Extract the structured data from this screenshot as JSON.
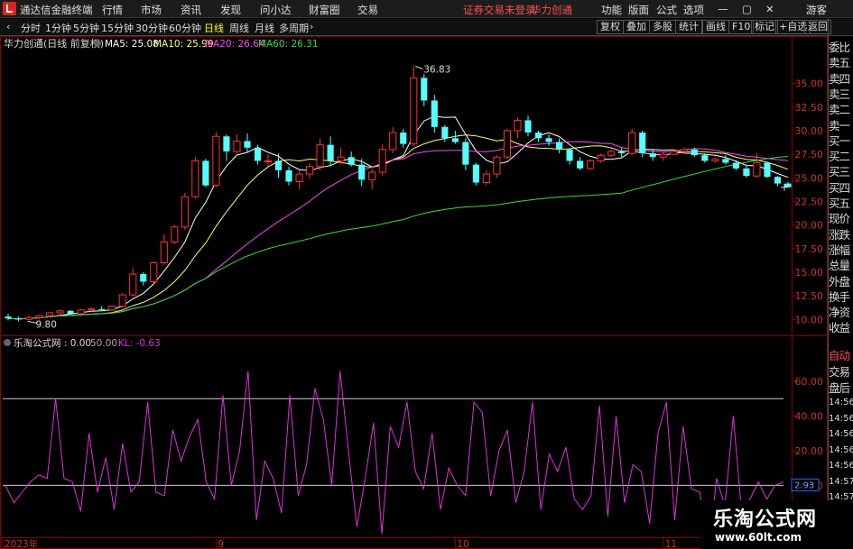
{
  "titlebar": {
    "app_name": "通达信金融终端",
    "menus": [
      "行情",
      "市场",
      "资讯",
      "发现",
      "问小达",
      "财富圈",
      "交易"
    ],
    "notice": "证券交易未登录",
    "stock_name": "华力创通",
    "right_menus": [
      "功能",
      "版面",
      "公式",
      "选项"
    ],
    "guest": "游客"
  },
  "toolbar": {
    "periods": [
      "分时",
      "1分钟",
      "5分钟",
      "15分钟",
      "30分钟",
      "60分钟",
      "日线",
      "周线",
      "月线",
      "多周期"
    ],
    "active_period": "日线",
    "buttons": [
      "复权",
      "叠加",
      "多股",
      "统计",
      "画线",
      "F10",
      "标记",
      "+自选",
      "返回"
    ]
  },
  "sidebar": {
    "items": [
      "委比",
      "卖五",
      "卖四",
      "卖三",
      "卖二",
      "卖一",
      "买一",
      "买二",
      "买三",
      "买四",
      "买五",
      "现价",
      "涨跌",
      "涨幅",
      "总量",
      "外盘",
      "换手",
      "净资",
      "收益"
    ],
    "lower_items": [
      "自动",
      "交易",
      "盘后"
    ],
    "times": [
      "14:56",
      "14:56",
      "14:56",
      "14:56",
      "14:56",
      "14:57",
      "14:57"
    ]
  },
  "main_chart": {
    "stock_title": "华力创通(日线 前复权)",
    "ma": [
      {
        "label": "MA5: 25.08",
        "color": "#ffffff"
      },
      {
        "label": "MA10: 25.99",
        "color": "#ffff66"
      },
      {
        "label": "MA20: 26.64",
        "color": "#ff44ff"
      },
      {
        "label": "MA60: 26.31",
        "color": "#33dd33"
      }
    ],
    "high_label": "36.83",
    "low_label": "9.80",
    "current_price": "24.00"
  },
  "indicator": {
    "title": "乐淘公式网 : 0.00",
    "param": "50.00",
    "kl": "KL: -0.63",
    "value_badge": "2.93"
  },
  "time_axis": {
    "labels": [
      {
        "text": "2023年",
        "idx": 0
      },
      {
        "text": "9",
        "idx": 20
      },
      {
        "text": "10",
        "idx": 43
      },
      {
        "text": "11",
        "idx": 63
      }
    ]
  },
  "watermark": {
    "title": "乐淘公式网",
    "url": "www.60lt.com"
  },
  "chart_data": [
    {
      "type": "candlestick",
      "title": "华力创通(日线 前复权)",
      "ylim": [
        8.5,
        38.5
      ],
      "y_ticks": [
        10.0,
        12.5,
        15.0,
        17.5,
        20.0,
        22.5,
        25.0,
        27.5,
        30.0,
        32.5,
        35.0
      ],
      "candles": [
        [
          10.3,
          10.6,
          9.9,
          10.1
        ],
        [
          10.1,
          10.3,
          9.8,
          10.0
        ],
        [
          10.0,
          10.4,
          9.9,
          10.2
        ],
        [
          10.2,
          10.5,
          10.0,
          10.4
        ],
        [
          10.4,
          10.8,
          10.2,
          10.7
        ],
        [
          10.7,
          11.0,
          10.5,
          10.9
        ],
        [
          10.9,
          11.0,
          10.5,
          10.6
        ],
        [
          10.6,
          11.1,
          10.5,
          11.0
        ],
        [
          11.0,
          11.3,
          10.8,
          11.1
        ],
        [
          11.1,
          11.4,
          10.9,
          11.0
        ],
        [
          11.0,
          11.5,
          10.9,
          11.4
        ],
        [
          11.4,
          12.8,
          11.2,
          12.6
        ],
        [
          12.6,
          15.5,
          12.4,
          14.8
        ],
        [
          14.8,
          15.0,
          13.6,
          14.0
        ],
        [
          14.0,
          16.2,
          13.8,
          16.0
        ],
        [
          16.0,
          19.0,
          15.8,
          18.2
        ],
        [
          18.2,
          20.0,
          18.0,
          19.8
        ],
        [
          19.8,
          23.4,
          19.5,
          23.0
        ],
        [
          23.0,
          27.2,
          22.8,
          26.8
        ],
        [
          26.8,
          27.0,
          24.0,
          24.2
        ],
        [
          24.2,
          29.8,
          24.0,
          29.4
        ],
        [
          29.4,
          29.6,
          26.8,
          27.8
        ],
        [
          27.8,
          29.6,
          27.6,
          28.9
        ],
        [
          28.9,
          29.7,
          27.7,
          28.2
        ],
        [
          28.2,
          28.5,
          26.4,
          26.8
        ],
        [
          26.8,
          27.5,
          26.2,
          26.8
        ],
        [
          26.8,
          27.6,
          25.0,
          25.8
        ],
        [
          25.8,
          26.2,
          24.2,
          24.6
        ],
        [
          24.6,
          25.8,
          23.8,
          25.4
        ],
        [
          25.4,
          26.6,
          24.9,
          26.2
        ],
        [
          26.2,
          29.2,
          25.8,
          28.5
        ],
        [
          28.5,
          29.4,
          26.2,
          26.8
        ],
        [
          26.8,
          28.2,
          26.4,
          27.2
        ],
        [
          27.2,
          27.8,
          26.2,
          26.4
        ],
        [
          26.4,
          27.0,
          24.1,
          24.8
        ],
        [
          24.8,
          26.0,
          23.8,
          25.6
        ],
        [
          25.6,
          28.6,
          25.2,
          28.0
        ],
        [
          28.0,
          30.4,
          27.6,
          29.8
        ],
        [
          29.8,
          30.2,
          28.2,
          28.6
        ],
        [
          28.6,
          36.83,
          28.4,
          35.6
        ],
        [
          35.6,
          36.0,
          32.6,
          33.2
        ],
        [
          33.2,
          33.8,
          29.8,
          30.4
        ],
        [
          30.4,
          30.6,
          28.8,
          29.2
        ],
        [
          29.2,
          30.0,
          28.6,
          28.8
        ],
        [
          28.8,
          29.2,
          25.8,
          26.4
        ],
        [
          26.4,
          26.6,
          24.2,
          24.5
        ],
        [
          24.5,
          25.8,
          24.2,
          25.4
        ],
        [
          25.4,
          27.4,
          25.0,
          27.2
        ],
        [
          27.2,
          30.2,
          27.0,
          30.0
        ],
        [
          30.0,
          31.4,
          29.2,
          31.1
        ],
        [
          31.1,
          31.6,
          29.4,
          29.8
        ],
        [
          29.8,
          30.0,
          28.8,
          29.2
        ],
        [
          29.2,
          29.6,
          28.4,
          28.8
        ],
        [
          28.8,
          29.2,
          27.6,
          28.0
        ],
        [
          28.0,
          28.2,
          26.4,
          26.8
        ],
        [
          26.8,
          27.2,
          25.8,
          26.0
        ],
        [
          26.0,
          27.0,
          25.8,
          26.8
        ],
        [
          26.8,
          27.6,
          26.6,
          27.4
        ],
        [
          27.4,
          28.0,
          27.2,
          27.8
        ],
        [
          27.8,
          28.2,
          27.2,
          27.6
        ],
        [
          27.6,
          30.2,
          27.4,
          29.8
        ],
        [
          29.8,
          30.0,
          27.2,
          27.6
        ],
        [
          27.6,
          28.0,
          26.8,
          27.2
        ],
        [
          27.2,
          27.8,
          26.8,
          27.5
        ],
        [
          27.5,
          28.0,
          27.4,
          27.8
        ],
        [
          27.8,
          28.2,
          27.6,
          28.0
        ],
        [
          28.0,
          28.2,
          27.2,
          27.4
        ],
        [
          27.4,
          27.6,
          26.6,
          26.8
        ],
        [
          26.8,
          27.2,
          26.6,
          27.0
        ],
        [
          27.0,
          27.4,
          26.4,
          26.6
        ],
        [
          26.6,
          26.9,
          25.8,
          26.0
        ],
        [
          26.0,
          26.4,
          25.0,
          25.2
        ],
        [
          25.2,
          27.6,
          25.0,
          26.6
        ],
        [
          26.6,
          26.7,
          25.0,
          25.1
        ],
        [
          25.1,
          25.2,
          24.1,
          24.4
        ],
        [
          24.4,
          24.6,
          24.0,
          24.0
        ]
      ]
    },
    {
      "type": "line",
      "title": "乐淘公式网",
      "ylim": [
        -30,
        72
      ],
      "y_ticks": [
        60,
        40,
        20,
        0,
        -20
      ],
      "ref_lines": [
        50,
        0
      ],
      "values": [
        0,
        -10,
        -4,
        2,
        6,
        4,
        50,
        4,
        2,
        -15,
        30,
        -4,
        16,
        -14,
        24,
        -4,
        2,
        48,
        -4,
        -6,
        32,
        14,
        28,
        38,
        2,
        -8,
        52,
        0,
        20,
        66,
        -20,
        14,
        4,
        -16,
        52,
        -6,
        12,
        56,
        38,
        0,
        66,
        20,
        -24,
        4,
        36,
        -28,
        34,
        22,
        48,
        8,
        -2,
        30,
        -14,
        10,
        0,
        -6,
        48,
        42,
        -6,
        20,
        32,
        -10,
        8,
        48,
        -14,
        18,
        8,
        22,
        -8,
        -14,
        -6,
        46,
        -18,
        40,
        -10,
        12,
        8,
        -22,
        30,
        48,
        -20,
        34,
        -2,
        -4,
        -42,
        4,
        -12,
        40,
        -16,
        -8,
        2,
        -8,
        0,
        2
      ],
      "kl": -0.63
    }
  ]
}
